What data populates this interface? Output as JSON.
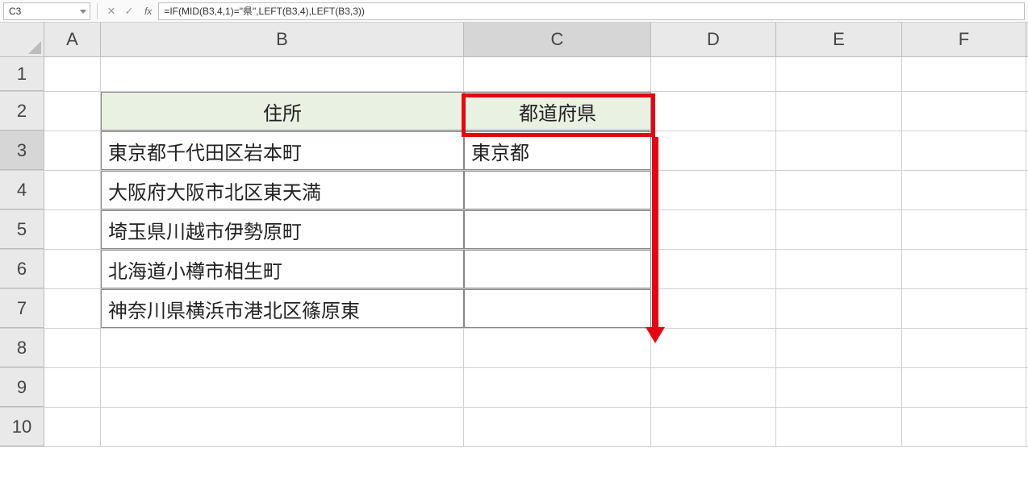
{
  "formula_bar": {
    "cell_ref": "C3",
    "fx_label": "fx",
    "formula": "=IF(MID(B3,4,1)=\"県\",LEFT(B3,4),LEFT(B3,3))"
  },
  "column_headers": [
    "A",
    "B",
    "C",
    "D",
    "E",
    "F"
  ],
  "row_headers": [
    "1",
    "2",
    "3",
    "4",
    "5",
    "6",
    "7",
    "8",
    "9",
    "10"
  ],
  "table": {
    "header_B": "住所",
    "header_C": "都道府県",
    "rows": [
      {
        "B": "東京都千代田区岩本町",
        "C": "東京都"
      },
      {
        "B": "大阪府大阪市北区東天満",
        "C": ""
      },
      {
        "B": "埼玉県川越市伊勢原町",
        "C": ""
      },
      {
        "B": "北海道小樽市相生町",
        "C": ""
      },
      {
        "B": "神奈川県横浜市港北区篠原東",
        "C": ""
      }
    ]
  },
  "selected_cell": "C3"
}
